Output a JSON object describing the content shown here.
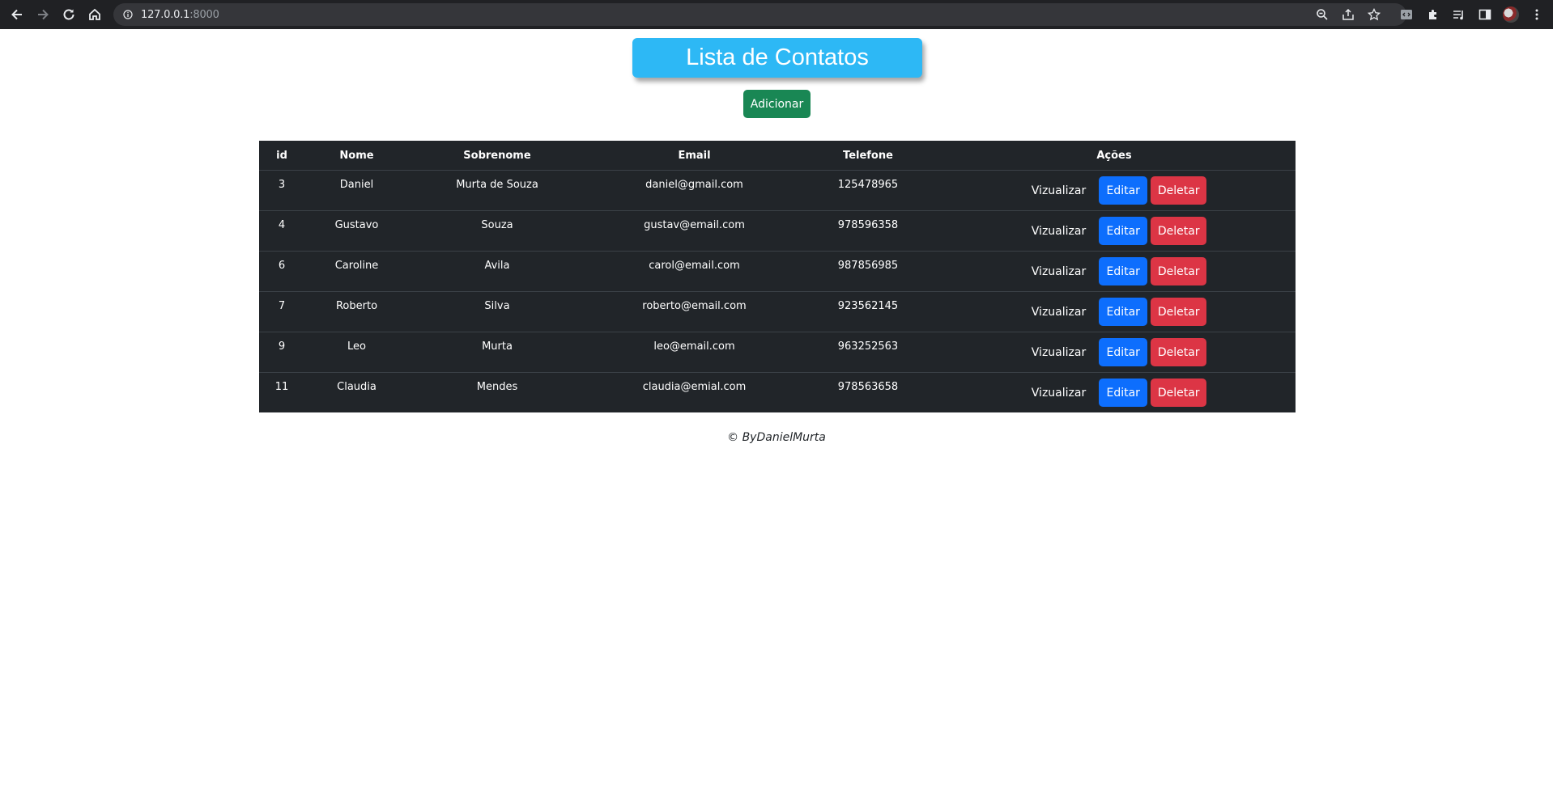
{
  "browser": {
    "url_host": "127.0.0.1",
    "url_port": ":8000",
    "icons": [
      "back-icon",
      "forward-icon",
      "reload-icon",
      "home-icon",
      "info-icon",
      "zoom-icon",
      "share-icon",
      "star-icon",
      "devtools-extension-icon",
      "puzzle-icon",
      "reading-list-icon",
      "sidebar-icon",
      "profile-avatar",
      "menu-icon"
    ]
  },
  "page": {
    "title": "Lista de Contatos",
    "add_label": "Adicionar",
    "footer": "© ByDanielMurta"
  },
  "table": {
    "headers": [
      "id",
      "Nome",
      "Sobrenome",
      "Email",
      "Telefone",
      "Ações"
    ],
    "rows": [
      {
        "id": "3",
        "nome": "Daniel",
        "sobrenome": "Murta de Souza",
        "email": "daniel@gmail.com",
        "telefone": "125478965"
      },
      {
        "id": "4",
        "nome": "Gustavo",
        "sobrenome": "Souza",
        "email": "gustav@email.com",
        "telefone": "978596358"
      },
      {
        "id": "6",
        "nome": "Caroline",
        "sobrenome": "Avila",
        "email": "carol@email.com",
        "telefone": "987856985"
      },
      {
        "id": "7",
        "nome": "Roberto",
        "sobrenome": "Silva",
        "email": "roberto@email.com",
        "telefone": "923562145"
      },
      {
        "id": "9",
        "nome": "Leo",
        "sobrenome": "Murta",
        "email": "leo@email.com",
        "telefone": "963252563"
      },
      {
        "id": "11",
        "nome": "Claudia",
        "sobrenome": "Mendes",
        "email": "claudia@emial.com",
        "telefone": "978563658"
      }
    ],
    "actions": {
      "view": "Vizualizar",
      "edit": "Editar",
      "delete": "Deletar"
    }
  },
  "colors": {
    "title_bg": "#2db8f5",
    "add": "#198754",
    "edit": "#0d6efd",
    "delete": "#dc3545",
    "table_bg": "#212529"
  }
}
